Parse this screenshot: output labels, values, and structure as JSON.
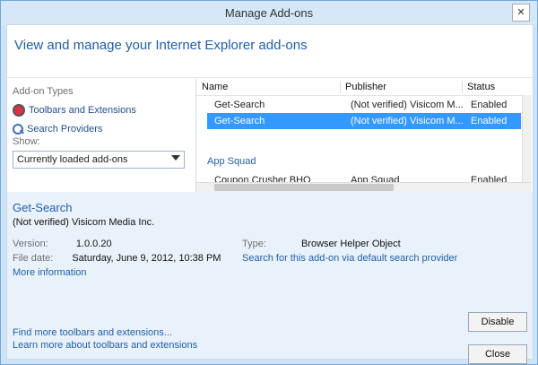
{
  "window": {
    "title": "Manage Add-ons",
    "close_label": "✕"
  },
  "header": {
    "text": "View and manage your Internet Explorer add-ons"
  },
  "sidebar": {
    "addon_types_label": "Add-on Types",
    "items": [
      {
        "label": "Toolbars and Extensions",
        "icon": "gear-icon"
      },
      {
        "label": "Search Providers",
        "icon": "search-icon"
      }
    ],
    "show_label": "Show:",
    "show_selected": "Currently loaded add-ons"
  },
  "list": {
    "headers": {
      "name": "Name",
      "publisher": "Publisher",
      "status": "Status"
    },
    "rows": [
      {
        "name": "Get-Search",
        "publisher": "(Not verified) Visicom M...",
        "status": "Enabled",
        "selected": false
      },
      {
        "name": "Get-Search",
        "publisher": "(Not verified) Visicom M...",
        "status": "Enabled",
        "selected": true
      }
    ],
    "group_label": "App Squad",
    "group_row": {
      "name": "Coupon Crusher BHO",
      "publisher": "App Squad",
      "status": "Enabled"
    }
  },
  "details": {
    "title": "Get-Search",
    "subtitle": "(Not verified) Visicom Media Inc.",
    "version_label": "Version:",
    "version_value": "1.0.0.20",
    "filedate_label": "File date:",
    "filedate_value": "Saturday, June 9, 2012, 10:38 PM",
    "more_info": "More information",
    "type_label": "Type:",
    "type_value": "Browser Helper Object",
    "search_link": "Search for this add-on via default search provider",
    "disable_button": "Disable",
    "close_button": "Close",
    "footer_link_1": "Find more toolbars and extensions...",
    "footer_link_2": "Learn more about toolbars and extensions"
  }
}
